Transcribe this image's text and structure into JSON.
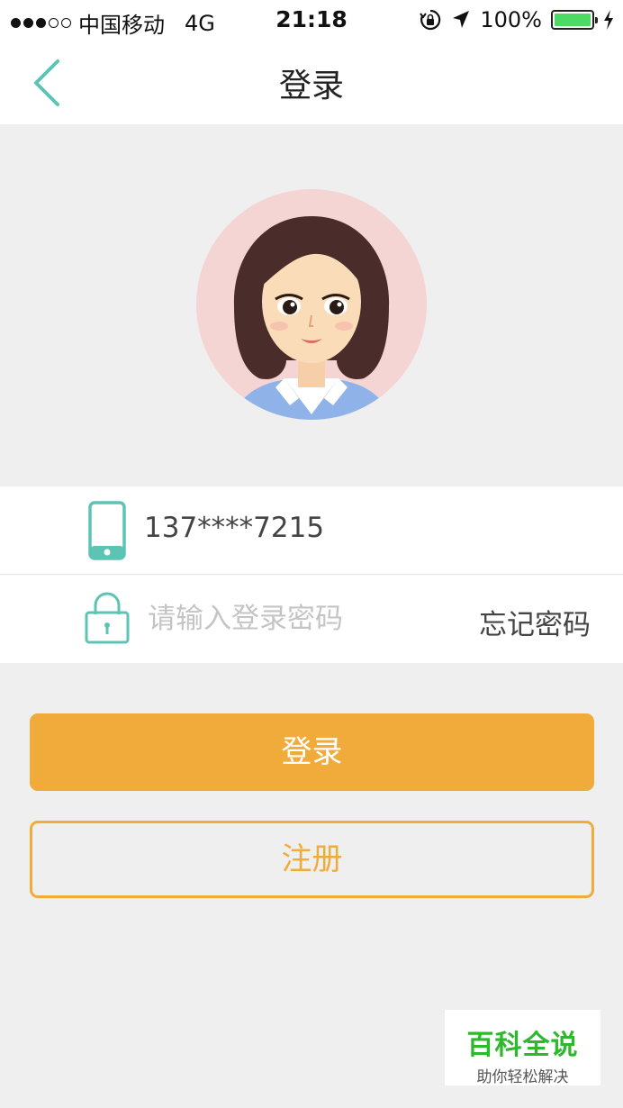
{
  "status_bar": {
    "signal_dots": [
      true,
      true,
      true,
      false,
      false
    ],
    "carrier": "中国移动",
    "network": "4G",
    "time": "21:18",
    "battery": "100%",
    "battery_level": 1.0,
    "icons": [
      "orientation-lock-icon",
      "location-icon",
      "battery-icon",
      "charging-icon"
    ]
  },
  "nav": {
    "title": "登录",
    "back_icon": "chevron-left-icon"
  },
  "form": {
    "phone_value": "137****7215",
    "phone_icon": "phone-icon",
    "password_placeholder": "请输入登录密码",
    "password_icon": "lock-icon",
    "forgot_password": "忘记密码"
  },
  "buttons": {
    "login": "登录",
    "register": "注册"
  },
  "watermark": {
    "title": "百科全说",
    "subtitle": "助你轻松解决"
  },
  "colors": {
    "accent_teal": "#5cc4b4",
    "accent_orange": "#f0ab3b",
    "background": "#efefef",
    "battery_green": "#4cd964",
    "watermark_green": "#2eb82e"
  }
}
